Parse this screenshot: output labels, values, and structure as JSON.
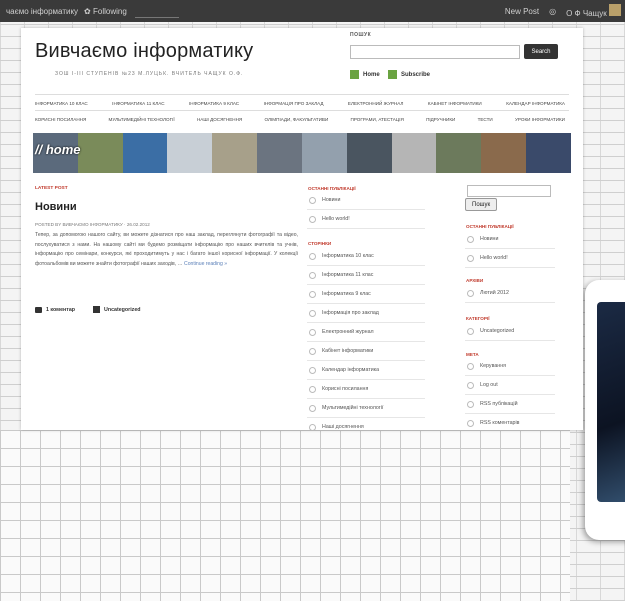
{
  "admin_bar": {
    "site": "чаємо інформатику",
    "following": "Following",
    "new_post": "New Post",
    "user": "О Ф Чащук"
  },
  "site": {
    "title": "Вивчаємо інформатику",
    "description": "ЗОШ І-ІІІ СТУПЕНІВ №23 М.ЛУЦЬК. ВЧИТЕЛЬ ЧАЩУК О.Ф."
  },
  "header_search": {
    "label": "ПОШУК",
    "button": "Search",
    "home": "Home",
    "subscribe": "Subscribe"
  },
  "nav_row1": [
    "ІНФОРМАТИКА 10 КЛАС",
    "ІНФОРМАТИКА 11 КЛАС",
    "ІНФОРМАТИКА 9 КЛАС",
    "ІНФОРМАЦІЯ ПРО ЗАКЛАД",
    "ЕЛЕКТРОННИЙ ЖУРНАЛ",
    "КАБІНЕТ ІНФОРМАТИКИ",
    "КАЛЕНДАР ІНФОРМАТИКА"
  ],
  "nav_row2": [
    "КОРИСНІ ПОСИЛАННЯ",
    "МУЛЬТИМЕДІЙНІ ТЕХНОЛОГІЇ",
    "НАШІ ДОСЯГНЕННЯ",
    "ОЛІМПІАДИ, ФАКУЛЬТАТИВИ",
    "ПРОГРАМИ, АТЕСТАЦІЯ",
    "ПІДРУЧНИКИ",
    "ТЕСТИ",
    "УРОКИ ІНФОРМАТИКИ"
  ],
  "banner": {
    "label": "// home",
    "tile_colors": [
      "#5b6a7c",
      "#7a8b5a",
      "#3b6ea5",
      "#c8cfd6",
      "#a7a08a",
      "#6b7480",
      "#93a0ad",
      "#4a5560",
      "#b5b5b5",
      "#6c7a5c",
      "#8a6a4c",
      "#3a4a6a"
    ]
  },
  "post": {
    "latest_label": "LATEST POST",
    "title": "Новини",
    "meta": "POSTED BY ВИВЧАЄМО ІНФОРМАТИКУ · 26.02.2012",
    "body": "Тепер, за допомогою нашого сайту, ви можете дізнатися про наш заклад, переглянути фотографії та відео, послухуватися з нами. На нашому сайті ми будемо розміщати інформацію про наших вчителів та учнів, інформацію про семінари, конкурси, які проходитимуть у нас і багато іншої корисної інформації. У колекції фотоальбомів ви можете знайти фотографії наших заходів, … ",
    "more": "Continue reading »",
    "comments": "1 коментар",
    "category": "Uncategorized"
  },
  "middle_col": {
    "recent_head": "ОСТАННІ ПУБЛІКАЦІЇ",
    "recent": [
      "Новини",
      "Hello world!"
    ],
    "pages_head": "СТОРІНКИ",
    "pages": [
      "Інформатика 10 клас",
      "Інформатика 11 клас",
      "Інформатика 9 клас",
      "Інформація про заклад",
      "Електронний журнал",
      "Кабінет інформатики",
      "Календар інформатика",
      "Корисні посилання",
      "Мультимедійні технології",
      "Наші досягнення"
    ]
  },
  "right_col": {
    "search_button": "Пошук",
    "recent_head": "ОСТАННІ ПУБЛІКАЦІЇ",
    "recent": [
      "Новини",
      "Hello world!"
    ],
    "archives_head": "АРХІВИ",
    "archives": [
      "Лютий 2012"
    ],
    "categories_head": "КАТЕГОРІЇ",
    "categories": [
      "Uncategorized"
    ],
    "meta_head": "МЕТА",
    "meta": [
      "Керування",
      "Log out",
      "RSS публікацій",
      "RSS коментарів"
    ]
  }
}
